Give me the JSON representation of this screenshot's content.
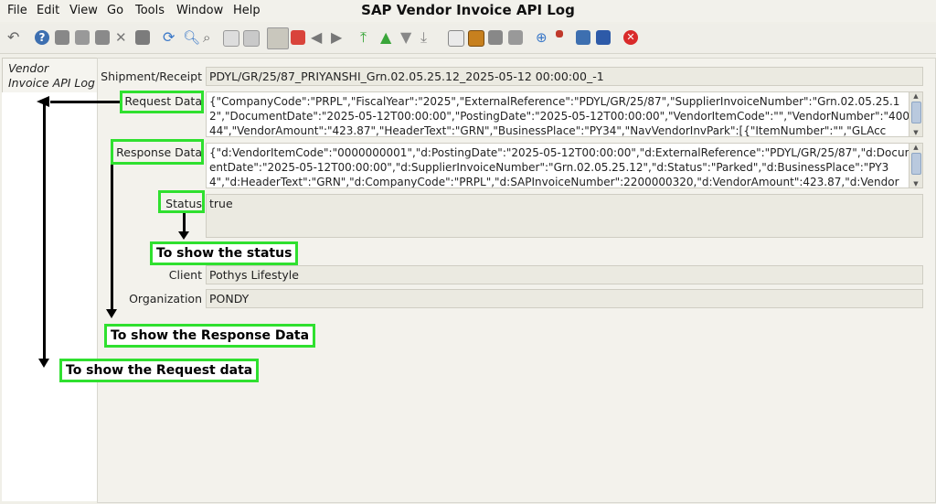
{
  "window": {
    "title": "SAP Vendor Invoice API Log"
  },
  "menu": [
    "File",
    "Edit",
    "View",
    "Go",
    "Tools",
    "Window",
    "Help"
  ],
  "toolbar_icons": [
    "undo-icon",
    "help-icon",
    "new-icon",
    "copy-icon",
    "delete-icon",
    "delete-selection-icon",
    "save-icon",
    "refresh-icon",
    "find-icon",
    "attachment-icon",
    "chat-icon",
    "history-icon",
    "grid-toggle-icon",
    "home-icon",
    "back-icon",
    "forward-icon",
    "first-record-icon",
    "previous-record-icon",
    "next-record-icon",
    "last-record-icon",
    "report-icon",
    "archive-icon",
    "print-preview-icon",
    "print-icon",
    "zoom-across-icon",
    "workflow-icon",
    "product-info-icon",
    "close-window-icon"
  ],
  "left_tab": {
    "line1": "Vendor",
    "line2": "Invoice API Log"
  },
  "form": {
    "shipment_label": "Shipment/Receipt",
    "shipment_value": "PDYL/GR/25/87_PRIYANSHI_Grn.02.05.25.12_2025-05-12 00:00:00_-1",
    "request_label": "Request Data",
    "request_value": "{\"CompanyCode\":\"PRPL\",\"FiscalYear\":\"2025\",\"ExternalReference\":\"PDYL/GR/25/87\",\"SupplierInvoiceNumber\":\"Grn.02.05.25.12\",\"DocumentDate\":\"2025-05-12T00:00:00\",\"PostingDate\":\"2025-05-12T00:00:00\",\"VendorItemCode\":\"\",\"VendorNumber\":\"400144\",\"VendorAmount\":\"423.87\",\"HeaderText\":\"GRN\",\"BusinessPlace\":\"PY34\",\"NavVendorInvPark\":[{\"ItemNumber\":\"\",\"GLAcc",
    "response_label": "Response Data",
    "response_value": "{\"d:VendorItemCode\":\"0000000001\",\"d:PostingDate\":\"2025-05-12T00:00:00\",\"d:ExternalReference\":\"PDYL/GR/25/87\",\"d:DocumentDate\":\"2025-05-12T00:00:00\",\"d:SupplierInvoiceNumber\":\"Grn.02.05.25.12\",\"d:Status\":\"Parked\",\"d:BusinessPlace\":\"PY34\",\"d:HeaderText\":\"GRN\",\"d:CompanyCode\":\"PRPL\",\"d:SAPInvoiceNumber\":2200000320,\"d:VendorAmount\":423.87,\"d:Vendor",
    "status_label": "Status",
    "status_value": "true",
    "client_label": "Client",
    "client_value": "Pothys Lifestyle",
    "org_label": "Organization",
    "org_value": "PONDY"
  },
  "annotations": {
    "status_note": "To show the status",
    "response_note": "To show the Response Data",
    "request_note": "To show the Request data",
    "highlight_color": "#2fe02f"
  }
}
